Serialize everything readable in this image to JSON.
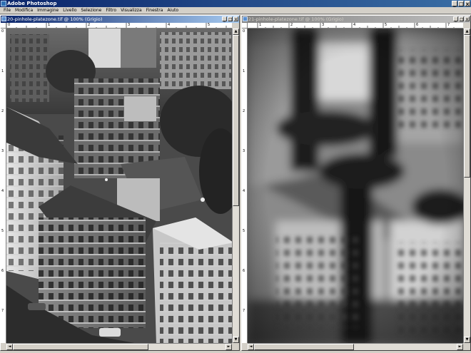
{
  "app": {
    "title": "Adobe Photoshop"
  },
  "menu": [
    "File",
    "Modifica",
    "Immagine",
    "Livello",
    "Selezione",
    "Filtro",
    "Visualizza",
    "Finestra",
    "Aiuto"
  ],
  "window_buttons": {
    "minimize": "_",
    "maximize": "□",
    "close": "×"
  },
  "documents": [
    {
      "title": "20-pinhole-platezone.tif @ 100% (Grigio)",
      "active": true,
      "ruler_top": [
        "0",
        "1",
        "2",
        "3",
        "4",
        "5"
      ],
      "ruler_left": [
        "0",
        "1",
        "2",
        "3",
        "4",
        "5",
        "6",
        "7"
      ]
    },
    {
      "title": "21-pinhole-platezone.tif @ 100% (Grigio)",
      "active": false,
      "ruler_top": [
        "1",
        "2",
        "3",
        "4",
        "5",
        "6",
        "7"
      ],
      "ruler_left": [
        "0",
        "1",
        "2",
        "3",
        "4",
        "5",
        "6",
        "7"
      ]
    }
  ],
  "scrollbars": {
    "up": "▲",
    "down": "▼",
    "left": "◄",
    "right": "►"
  },
  "colors": {
    "titlebar_start": "#0a246a",
    "titlebar_end": "#3a6ea5",
    "chrome": "#d4d0c8"
  }
}
